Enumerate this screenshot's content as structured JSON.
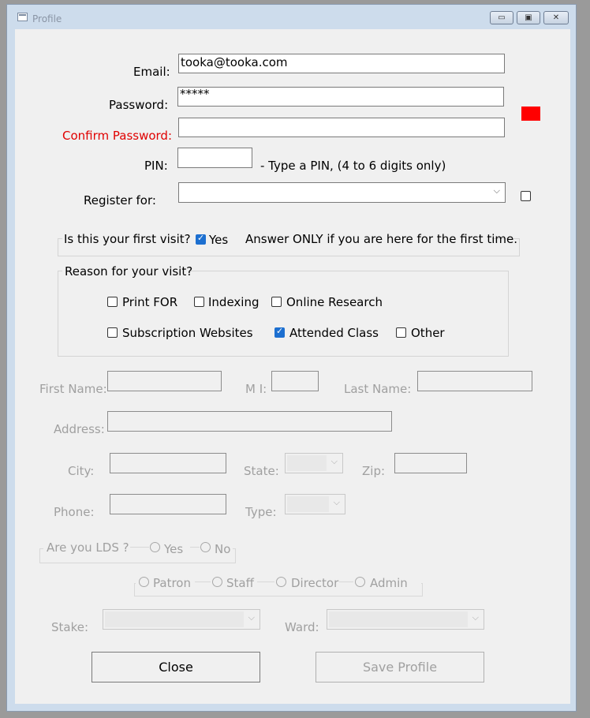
{
  "window": {
    "title": "Profile",
    "controls": {
      "minimize": "▭",
      "maximize": "▣",
      "close": "✕"
    }
  },
  "form": {
    "email_label": "Email:",
    "email_value": "tooka@tooka.com",
    "password_label": "Password:",
    "password_value": "*****",
    "confirm_password_label": "Confirm Password:",
    "confirm_password_value": "",
    "pin_label": "PIN:",
    "pin_value": "",
    "pin_hint": "- Type a PIN, (4 to 6 digits only)",
    "register_label": "Register for:",
    "register_value": "",
    "register_checked": false,
    "indicator_color": "#ff0000"
  },
  "first_visit": {
    "question": "Is this your first visit?",
    "yes_label": "Yes",
    "yes_checked": true,
    "note": "Answer ONLY if you are here for the first time."
  },
  "reason": {
    "title": "Reason for your visit?",
    "options": [
      {
        "label": "Print FOR",
        "checked": false
      },
      {
        "label": "Indexing",
        "checked": false
      },
      {
        "label": "Online Research",
        "checked": false
      },
      {
        "label": "Subscription Websites",
        "checked": false
      },
      {
        "label": "Attended Class",
        "checked": true
      },
      {
        "label": "Other",
        "checked": false
      }
    ]
  },
  "personal": {
    "first_name_label": "First Name:",
    "mi_label": "M I:",
    "last_name_label": "Last Name:",
    "address_label": "Address:",
    "city_label": "City:",
    "state_label": "State:",
    "zip_label": "Zip:",
    "phone_label": "Phone:",
    "type_label": "Type:"
  },
  "lds": {
    "question": "Are you LDS ?",
    "yes_label": "Yes",
    "no_label": "No"
  },
  "role": {
    "options": [
      "Patron",
      "Staff",
      "Director",
      "Admin"
    ]
  },
  "church": {
    "stake_label": "Stake:",
    "ward_label": "Ward:"
  },
  "buttons": {
    "close_label": "Close",
    "save_label": "Save Profile"
  },
  "colors": {
    "accent": "#1c6fd0",
    "required_label": "#e00000",
    "disabled_text": "#a0a0a0"
  }
}
